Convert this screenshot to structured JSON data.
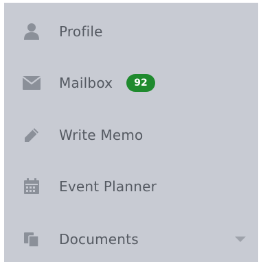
{
  "sidebar": {
    "items": [
      {
        "label": "Profile",
        "icon": "user-icon"
      },
      {
        "label": "Mailbox",
        "icon": "envelope-icon",
        "badge": "92"
      },
      {
        "label": "Write Memo",
        "icon": "pencil-icon"
      },
      {
        "label": "Event Planner",
        "icon": "calendar-icon"
      },
      {
        "label": "Documents",
        "icon": "documents-icon",
        "dropdown": "chevron-down-icon"
      }
    ]
  },
  "colors": {
    "sidebar_bg": "#c8cbd3",
    "text": "#555a62",
    "icon": "#8b9099",
    "badge_bg": "#1f8a2e",
    "badge_text": "#ffffff"
  }
}
